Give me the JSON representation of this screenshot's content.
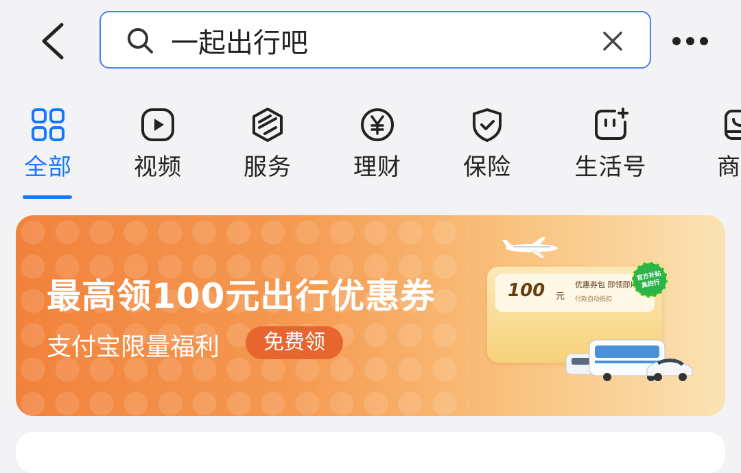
{
  "search": {
    "value": "一起出行吧"
  },
  "tabs": [
    {
      "label": "全部",
      "icon": "grid-icon",
      "active": true
    },
    {
      "label": "视频",
      "icon": "play-icon"
    },
    {
      "label": "服务",
      "icon": "services-icon"
    },
    {
      "label": "理财",
      "icon": "yen-icon"
    },
    {
      "label": "保险",
      "icon": "shield-icon"
    },
    {
      "label": "生活号",
      "icon": "face-sparkle-icon"
    },
    {
      "label": "商品",
      "icon": "shop-icon"
    }
  ],
  "banner": {
    "headline": "最高领100元出行优惠券",
    "subtitle": "支付宝限量福利",
    "cta": "免费领",
    "coupon": {
      "amount": "100",
      "unit": "元",
      "title": "优惠券包 即领即用",
      "desc": "付款自动抵扣",
      "badge": "官方补贴 真的行"
    }
  },
  "colors": {
    "accent": "#1677ff",
    "banner_orange": "#f1823c",
    "cta": "#e7662f"
  }
}
